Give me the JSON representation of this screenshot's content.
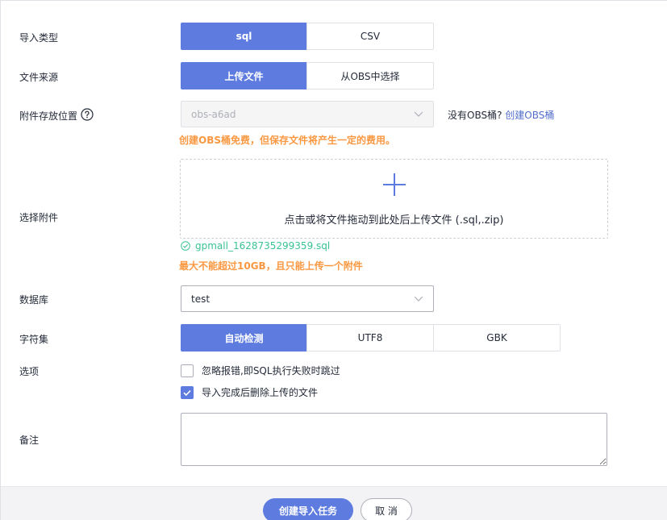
{
  "labels": {
    "import_type": "导入类型",
    "file_source": "文件来源",
    "attachment_location": "附件存放位置",
    "select_attachment": "选择附件",
    "database": "数据库",
    "charset": "字符集",
    "options": "选项",
    "remark": "备注"
  },
  "import_type": {
    "options": [
      "sql",
      "CSV"
    ],
    "selected": "sql"
  },
  "file_source": {
    "options": [
      "上传文件",
      "从OBS中选择"
    ],
    "selected": "上传文件"
  },
  "obs": {
    "bucket_value": "obs-a6ad",
    "no_bucket_text": "没有OBS桶?",
    "create_link": "创建OBS桶",
    "fee_warning": "创建OBS桶免费，但保存文件将产生一定的费用。"
  },
  "upload": {
    "hint": "点击或将文件拖动到此处后上传文件 (.sql,.zip)",
    "uploaded_file": "gpmall_1628735299359.sql",
    "limit_warning": "最大不能超过10GB，且只能上传一个附件"
  },
  "database": {
    "value": "test"
  },
  "charset": {
    "options": [
      "自动检测",
      "UTF8",
      "GBK"
    ],
    "selected": "自动检测"
  },
  "option_checks": [
    {
      "label": "忽略报错,即SQL执行失败时跳过",
      "checked": false
    },
    {
      "label": "导入完成后删除上传的文件",
      "checked": true
    }
  ],
  "remark": {
    "value": ""
  },
  "footer": {
    "create_label": "创建导入任务",
    "cancel_label": "取 消"
  },
  "colors": {
    "primary": "#5e7ce0",
    "warning": "#fa9841",
    "success": "#3ac295",
    "link": "#526ecc"
  },
  "icons": {
    "help": "question-circle-icon",
    "chevron": "chevron-down-icon",
    "plus": "plus-icon",
    "check_circle": "check-circle-icon",
    "checkmark": "checkmark-icon"
  }
}
